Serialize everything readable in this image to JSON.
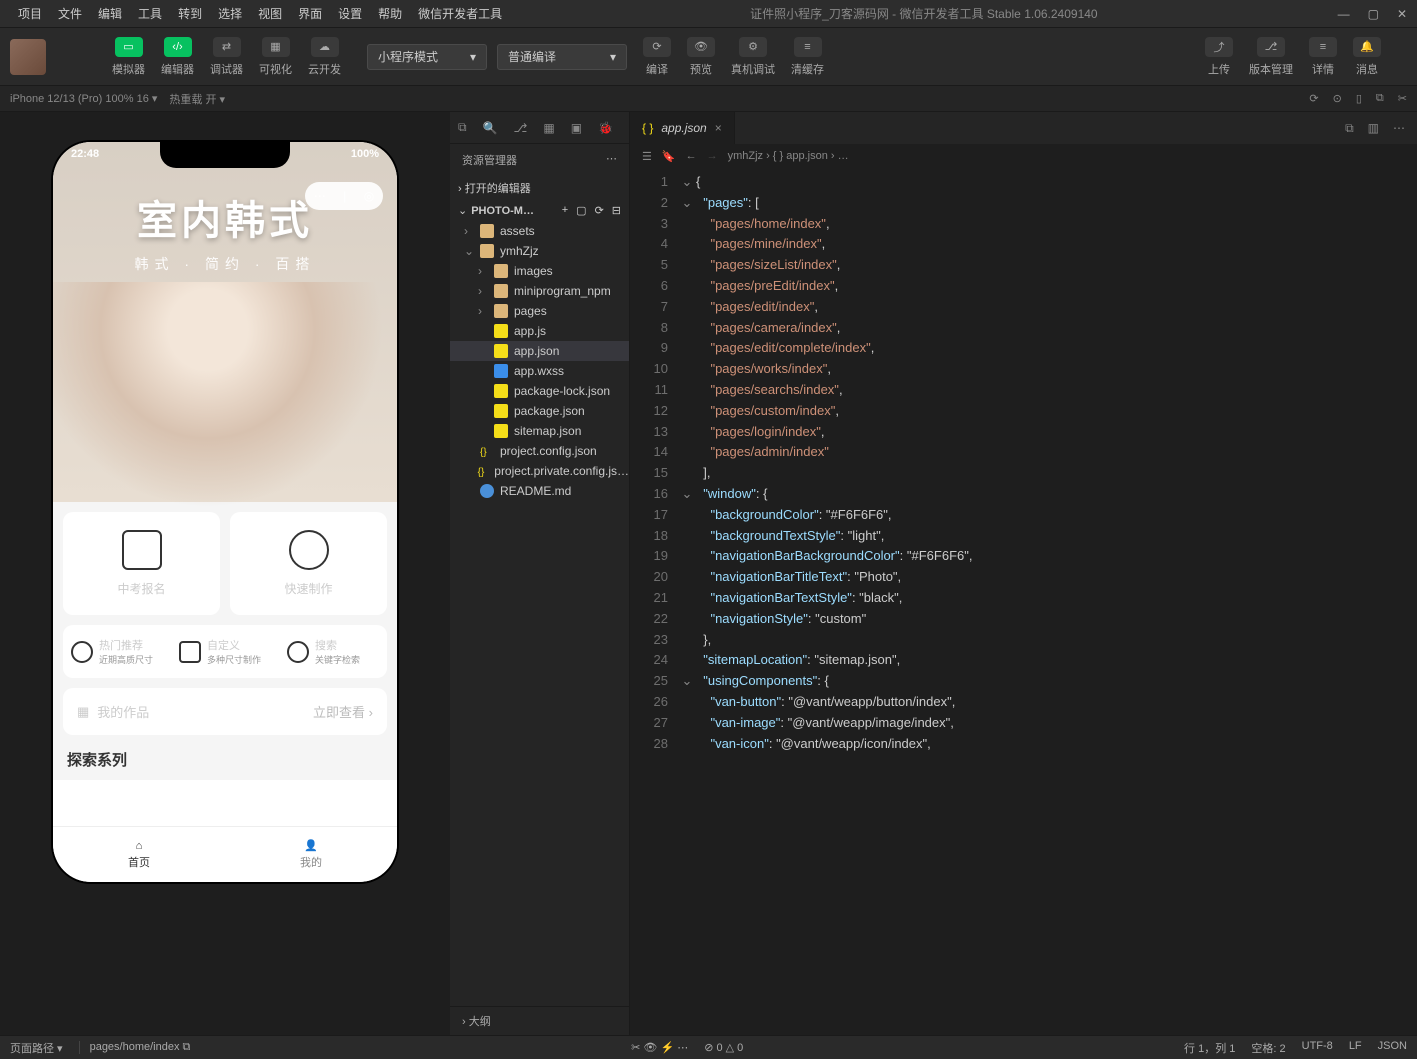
{
  "menubar": {
    "items": [
      "项目",
      "文件",
      "编辑",
      "工具",
      "转到",
      "选择",
      "视图",
      "界面",
      "设置",
      "帮助",
      "微信开发者工具"
    ],
    "title": "证件照小程序_刀客源码网 - 微信开发者工具 Stable 1.06.2409140"
  },
  "toolbar": {
    "simulator": "模拟器",
    "editor": "编辑器",
    "debugger": "调试器",
    "visualize": "可视化",
    "cloud": "云开发",
    "mode": "小程序模式",
    "compile_mode": "普通编译",
    "compile": "编译",
    "preview": "预览",
    "real": "真机调试",
    "cache": "清缓存",
    "upload": "上传",
    "version": "版本管理",
    "details": "详情",
    "messages": "消息"
  },
  "subbar": {
    "device": "iPhone 12/13 (Pro) 100% 16 ▾",
    "hotreload": "热重载 开 ▾"
  },
  "phone": {
    "time": "22:48",
    "battery": "100%",
    "hero_title": "室内韩式",
    "hero_sub": "韩式 · 简约 · 百搭",
    "card1": "中考报名",
    "card2": "快速制作",
    "mini1_title": "热门推荐",
    "mini1_sub": "近期高质尺寸",
    "mini2_title": "自定义",
    "mini2_sub": "多种尺寸制作",
    "mini3_title": "搜索",
    "mini3_sub": "关键字检索",
    "works": "我的作品",
    "works_action": "立即查看 ›",
    "explore": "探索系列",
    "tab_home": "首页",
    "tab_mine": "我的"
  },
  "explorer": {
    "title": "资源管理器",
    "opened": "打开的编辑器",
    "project": "PHOTO-M…",
    "tree": [
      {
        "icon": "folder",
        "name": "assets",
        "indent": 1,
        "chev": "›"
      },
      {
        "icon": "folder",
        "name": "ymhZjz",
        "indent": 1,
        "chev": "⌄"
      },
      {
        "icon": "folder",
        "name": "images",
        "indent": 2,
        "chev": "›"
      },
      {
        "icon": "folder",
        "name": "miniprogram_npm",
        "indent": 2,
        "chev": "›"
      },
      {
        "icon": "folder",
        "name": "pages",
        "indent": 2,
        "chev": "›"
      },
      {
        "icon": "js",
        "name": "app.js",
        "indent": 2
      },
      {
        "icon": "json",
        "name": "app.json",
        "indent": 2,
        "selected": true
      },
      {
        "icon": "css",
        "name": "app.wxss",
        "indent": 2
      },
      {
        "icon": "json",
        "name": "package-lock.json",
        "indent": 2
      },
      {
        "icon": "json",
        "name": "package.json",
        "indent": 2
      },
      {
        "icon": "json",
        "name": "sitemap.json",
        "indent": 2
      },
      {
        "icon": "json2",
        "name": "project.config.json",
        "indent": 1
      },
      {
        "icon": "json2",
        "name": "project.private.config.js…",
        "indent": 1
      },
      {
        "icon": "md",
        "name": "README.md",
        "indent": 1
      }
    ],
    "outline": "大纲"
  },
  "editor": {
    "tab_name": "app.json",
    "breadcrumb": "ymhZjz › { } app.json › …",
    "lines": [
      {
        "n": 1,
        "t": "{"
      },
      {
        "n": 2,
        "t": "  \"pages\": ["
      },
      {
        "n": 3,
        "t": "    \"pages/home/index\","
      },
      {
        "n": 4,
        "t": "    \"pages/mine/index\","
      },
      {
        "n": 5,
        "t": "    \"pages/sizeList/index\","
      },
      {
        "n": 6,
        "t": "    \"pages/preEdit/index\","
      },
      {
        "n": 7,
        "t": "    \"pages/edit/index\","
      },
      {
        "n": 8,
        "t": "    \"pages/camera/index\","
      },
      {
        "n": 9,
        "t": "    \"pages/edit/complete/index\","
      },
      {
        "n": 10,
        "t": "    \"pages/works/index\","
      },
      {
        "n": 11,
        "t": "    \"pages/searchs/index\","
      },
      {
        "n": 12,
        "t": "    \"pages/custom/index\","
      },
      {
        "n": 13,
        "t": "    \"pages/login/index\","
      },
      {
        "n": 14,
        "t": "    \"pages/admin/index\""
      },
      {
        "n": 15,
        "t": "  ],"
      },
      {
        "n": 16,
        "t": "  \"window\": {"
      },
      {
        "n": 17,
        "t": "    \"backgroundColor\": \"#F6F6F6\","
      },
      {
        "n": 18,
        "t": "    \"backgroundTextStyle\": \"light\","
      },
      {
        "n": 19,
        "t": "    \"navigationBarBackgroundColor\": \"#F6F6F6\","
      },
      {
        "n": 20,
        "t": "    \"navigationBarTitleText\": \"Photo\","
      },
      {
        "n": 21,
        "t": "    \"navigationBarTextStyle\": \"black\","
      },
      {
        "n": 22,
        "t": "    \"navigationStyle\": \"custom\""
      },
      {
        "n": 23,
        "t": "  },"
      },
      {
        "n": 24,
        "t": "  \"sitemapLocation\": \"sitemap.json\","
      },
      {
        "n": 25,
        "t": "  \"usingComponents\": {"
      },
      {
        "n": 26,
        "t": "    \"van-button\": \"@vant/weapp/button/index\","
      },
      {
        "n": 27,
        "t": "    \"van-image\": \"@vant/weapp/image/index\","
      },
      {
        "n": 28,
        "t": "    \"van-icon\": \"@vant/weapp/icon/index\","
      }
    ]
  },
  "statusbar": {
    "path_label": "页面路径 ▾",
    "path": "pages/home/index",
    "errors": "⊘ 0 △ 0",
    "pos": "行 1，列 1",
    "spaces": "空格: 2",
    "encoding": "UTF-8",
    "eol": "LF",
    "lang": "JSON"
  }
}
